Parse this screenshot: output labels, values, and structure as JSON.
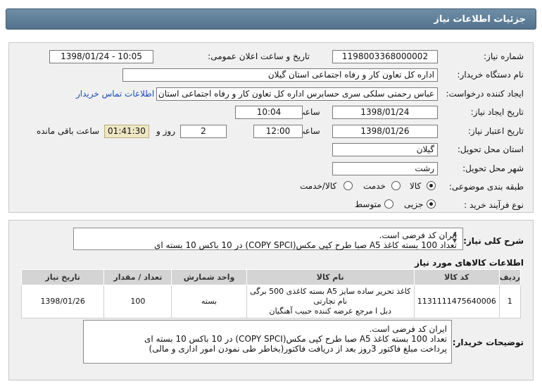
{
  "header": {
    "title": "جزئیات اطلاعات نیاز"
  },
  "form": {
    "need_number_label": "شماره نیاز:",
    "need_number": "1198003368000002",
    "announce_label": "تاریخ و ساعت اعلان عمومی:",
    "announce_value": "1398/01/24 - 10:05",
    "buyer_label": "نام دستگاه خریدار:",
    "buyer_value": "اداره کل تعاون کار و رفاه اجتماعی استان گیلان",
    "requester_label": "ایجاد کننده درخواست:",
    "requester_value": "عباس رحمتی سلکی سری حسابرس اداره کل تعاون کار و رفاه اجتماعی استان",
    "contact_link": "اطلاعات تماس خریدار",
    "created_label": "تاریخ ایجاد نیاز:",
    "created_date": "1398/01/24",
    "time_label": "ساعت",
    "created_time": "10:04",
    "valid_label": "تاریخ اعتبار نیاز:",
    "valid_date": "1398/01/26",
    "valid_time": "12:00",
    "days_value": "2",
    "days_label": "روز و",
    "remaining_value": "01:41:30",
    "remaining_label": "ساعت باقی مانده",
    "province_label": "استان محل تحویل:",
    "province_value": "گیلان",
    "city_label": "شهر محل تحویل:",
    "city_value": "رشت",
    "category_label": "طبقه بندی موضوعی:",
    "category_options": [
      "کالا",
      "خدمت",
      "کالا/خدمت"
    ],
    "purchase_label": "نوع فرآیند خرید :",
    "purchase_options": [
      "جزیی",
      "متوسط"
    ]
  },
  "summary": {
    "label": "شرح کلی نیاز:",
    "line1": "ایران کد فرضی است.",
    "line2": "تعداد 100 بسته کاغذ A5 صبا طرح کپی مکس(COPY SPCI) در 10 باکس 10 بسته ای"
  },
  "goods": {
    "title": "اطلاعات کالاهای مورد نیاز",
    "columns": [
      "ردیف",
      "کد کالا",
      "نام کالا",
      "واحد شمارش",
      "تعداد / مقدار",
      "تاریخ نیاز"
    ],
    "rows": [
      {
        "row": "1",
        "code": "1131111475640006",
        "name_line1": "کاغذ تحریر ساده سایز A5 بسته کاغذی 500 برگی نام تجارتی",
        "name_line2": "دبل ا مرجع عرضه کننده حبیب آهنگیان",
        "unit": "بسته",
        "qty": "100",
        "date": "1398/01/26"
      }
    ]
  },
  "buyer_notes": {
    "label": "توضیحات خریدار:",
    "line1": "ایران کد فرضی است.",
    "line2": "تعداد 100 بسته کاغذ A5 صبا طرح کپی مکس(COPY SPCI) در 10 باکس 10 بسته ای",
    "line3": "پرداخت مبلغ فاکتور 3روز بعد از دریافت فاکتور(بخاطر طی نمودن امور اداری و مالی)"
  }
}
